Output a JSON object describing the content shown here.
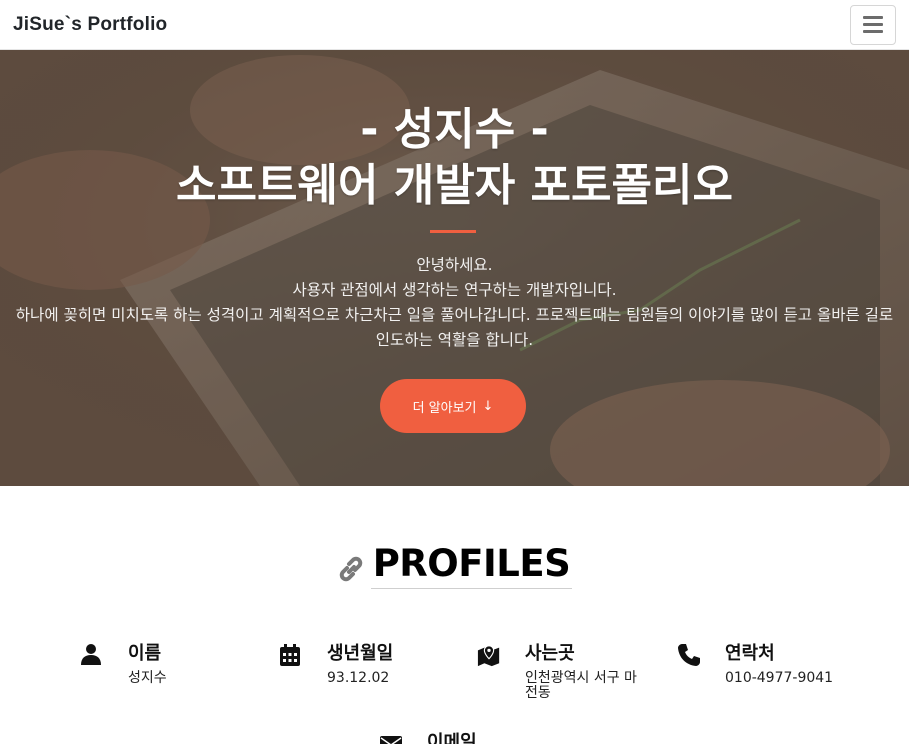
{
  "navbar": {
    "brand": "JiSue`s Portfolio",
    "menu_icon": "hamburger-menu-icon"
  },
  "hero": {
    "title_line1": "- 성지수 -",
    "title_line2": "소프트웨어 개발자 포토폴리오",
    "text_line1": "안녕하세요.",
    "text_line2": "사용자 관점에서 생각하는 연구하는 개발자입니다.",
    "text_line3": "하나에 꽂히면 미치도록 하는 성격이고 계획적으로 차근차근 일을 풀어나갑니다. 프로젝트때는 팀원들의 이야기를 많이 듣고 올바른 길로 인도하는 역활을 합니다.",
    "button_label": "더 알아보기",
    "button_arrow": "↓",
    "accent_color": "#f05f40"
  },
  "profiles": {
    "title": "PROFILES",
    "title_icon": "link-icon",
    "items": [
      {
        "icon": "user-icon",
        "label": "이름",
        "value": "성지수"
      },
      {
        "icon": "calendar-icon",
        "label": "생년월일",
        "value": "93.12.02"
      },
      {
        "icon": "map-marker-icon",
        "label": "사는곳",
        "value": "인천광역시 서구 마전동"
      },
      {
        "icon": "phone-icon",
        "label": "연락처",
        "value": "010-4977-9041"
      },
      {
        "icon": "envelope-icon",
        "label": "이메일",
        "value": ""
      }
    ]
  }
}
